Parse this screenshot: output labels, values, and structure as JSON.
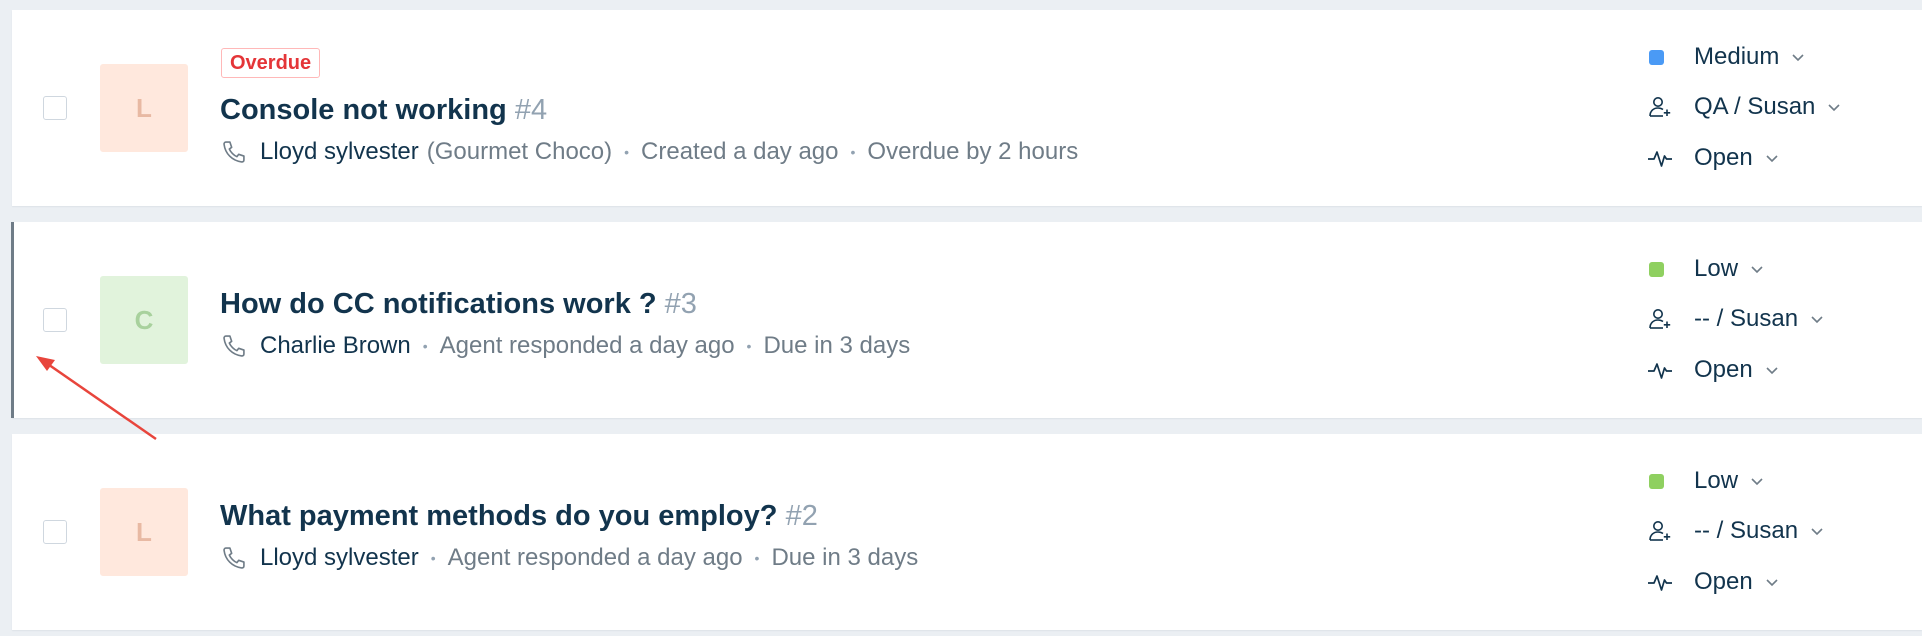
{
  "tickets": [
    {
      "badge": "Overdue",
      "title": "Console not working",
      "number": "#4",
      "avatar_letter": "L",
      "avatar_bg": "#ffe8dd",
      "avatar_fg": "#e8b9a3",
      "contact": "Lloyd sylvester",
      "company": "(Gourmet Choco)",
      "meta": [
        "Created a day ago",
        "Overdue by 2 hours"
      ],
      "priority": "Medium",
      "priority_color": "#4a9af5",
      "assignee": "QA / Susan",
      "status": "Open"
    },
    {
      "title": "How do CC notifications work ?",
      "number": "#3",
      "avatar_letter": "C",
      "avatar_bg": "#e1f3dc",
      "avatar_fg": "#a8d19d",
      "contact": "Charlie Brown",
      "meta": [
        "Agent responded a day ago",
        "Due in 3 days"
      ],
      "priority": "Low",
      "priority_color": "#8fd060",
      "assignee": "-- / Susan",
      "status": "Open"
    },
    {
      "title": "What payment methods do you employ?",
      "number": "#2",
      "avatar_letter": "L",
      "avatar_bg": "#ffe8dd",
      "avatar_fg": "#e8b9a3",
      "contact": "Lloyd sylvester",
      "meta": [
        "Agent responded a day ago",
        "Due in 3 days"
      ],
      "priority": "Low",
      "priority_color": "#8fd060",
      "assignee": "-- / Susan",
      "status": "Open"
    }
  ],
  "icons": {
    "contact": "phone-icon",
    "assignee": "agent-icon",
    "status": "status-pulse-icon",
    "dropdown": "chevron-down-icon"
  },
  "annotation": {
    "color": "#e8453c"
  }
}
